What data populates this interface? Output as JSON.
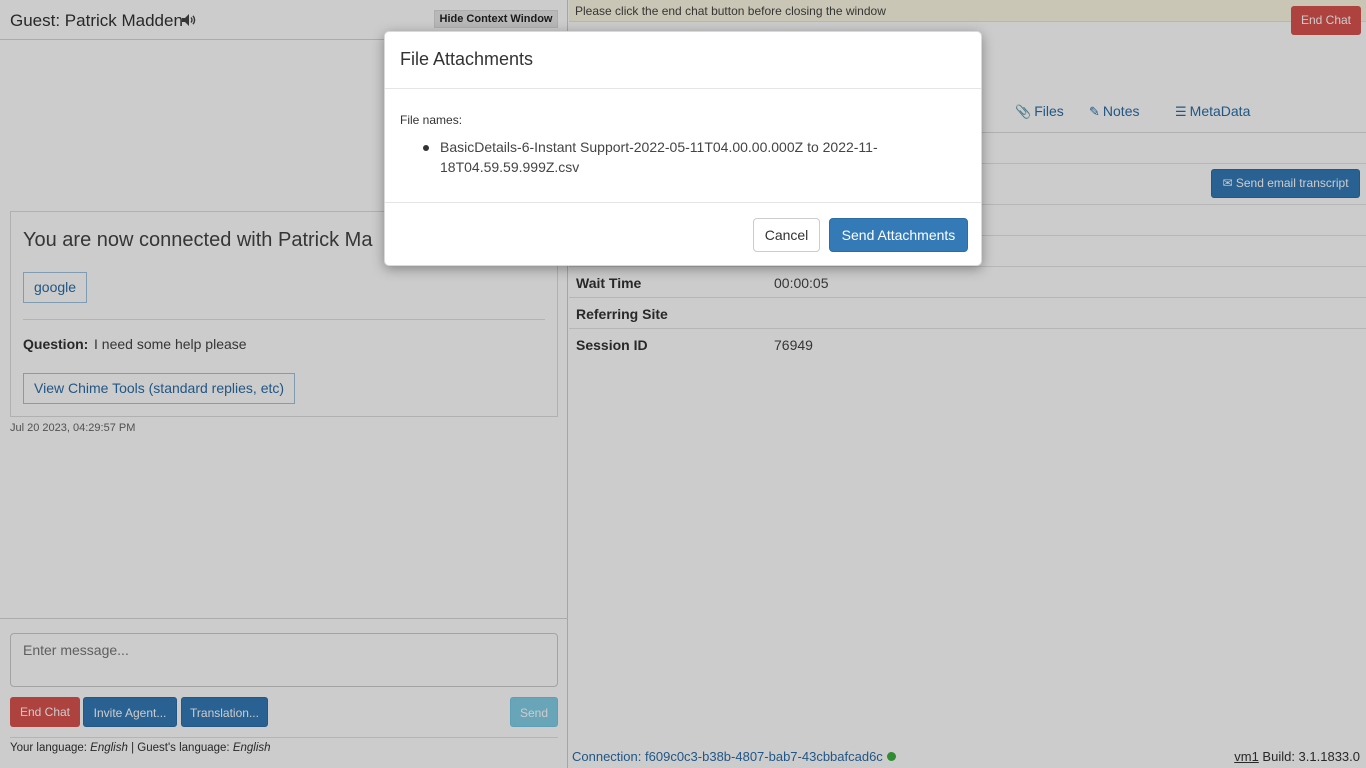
{
  "left": {
    "guest_title": "Guest: Patrick Madden",
    "hide_context_label": "Hide Context Window",
    "connected_text": "You are now connected with Patrick Ma",
    "google_tag": "google",
    "question_label": "Question:",
    "question_text": "I need some help please",
    "chime_tools_label": "View Chime Tools (standard replies, etc)",
    "message_time": "Jul 20 2023, 04:29:57 PM",
    "message_placeholder": "Enter message...",
    "buttons": {
      "end_chat": "End Chat",
      "invite_agent": "Invite Agent...",
      "translation": "Translation...",
      "send": "Send"
    },
    "language": {
      "your_label": "Your language:",
      "your_value": "English",
      "separator": "|",
      "guest_label": "Guest's language:",
      "guest_value": "English"
    }
  },
  "right": {
    "notice": "Please click the end chat button before closing the window",
    "end_chat": "End Chat",
    "tabs": [
      {
        "label": "Files",
        "icon": "paperclip-icon"
      },
      {
        "label": "Notes",
        "icon": "edit-icon"
      },
      {
        "label": "MetaData",
        "icon": "list-icon"
      }
    ],
    "send_email_transcript": "Send email transcript",
    "info_rows": [
      {
        "label": "Wait Time",
        "value": "00:00:05"
      },
      {
        "label": "Referring Site",
        "value": ""
      },
      {
        "label": "Session ID",
        "value": "76949"
      }
    ],
    "connection_label": "Connection:",
    "connection_id": "f609c0c3-b38b-4807-bab7-43cbbafcad6c",
    "connection_status_color": "#3db03d",
    "build_host": "vm1",
    "build_label": "Build: 3.1.1833.0"
  },
  "modal": {
    "title": "File Attachments",
    "file_names_label": "File names:",
    "files": [
      "BasicDetails-6-Instant Support-2022-05-11T04.00.00.000Z to 2022-11-18T04.59.59.999Z.csv"
    ],
    "cancel_label": "Cancel",
    "send_label": "Send Attachments"
  },
  "colors": {
    "primary": "#337ab7",
    "danger": "#d9534f",
    "info": "#5bc0de",
    "notice_bg": "#fcf8e3"
  }
}
